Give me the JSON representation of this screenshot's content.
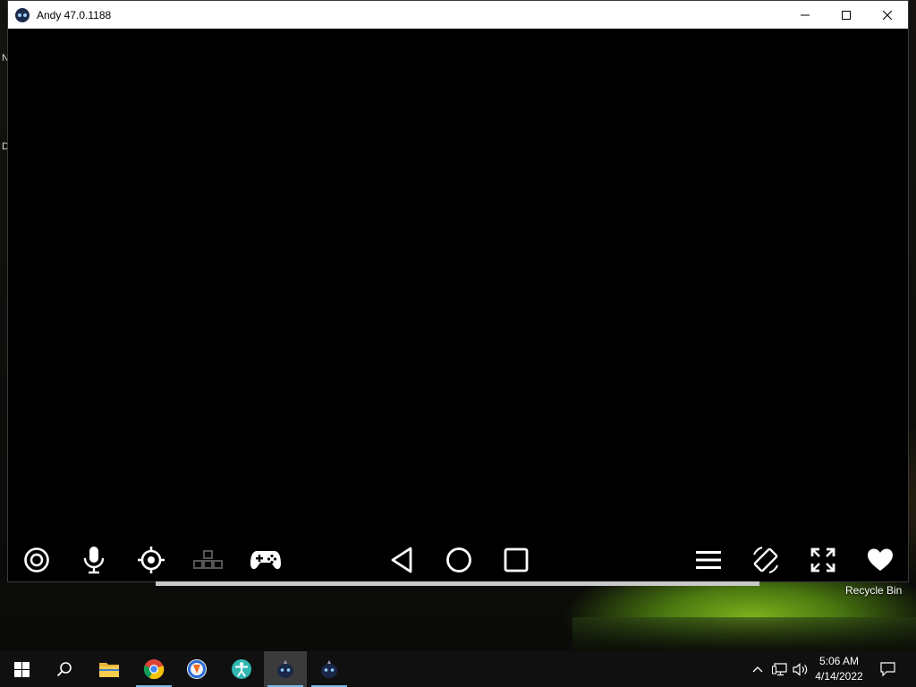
{
  "window": {
    "title": "Andy 47.0.1188",
    "app_icon": "andy-icon",
    "controls": [
      "minimize-icon",
      "maximize-icon",
      "close-icon"
    ]
  },
  "controlbar": {
    "left": [
      "camera-icon",
      "microphone-icon",
      "location-target-icon",
      "keyboard-keys-icon",
      "gamepad-icon"
    ],
    "center": [
      "back-icon",
      "home-icon",
      "recent-apps-icon"
    ],
    "right": [
      "menu-icon",
      "rotate-screen-icon",
      "fullscreen-icon",
      "favorite-heart-icon"
    ]
  },
  "desktop": {
    "edge_text_1": "N",
    "edge_text_2": "D",
    "recycle_bin_label": "Recycle Bin"
  },
  "taskbar": {
    "apps": [
      "start-icon",
      "search-icon",
      "file-explorer-icon",
      "chrome-icon",
      "brave-icon",
      "accessibility-app-icon",
      "andy-icon",
      "andy-icon"
    ],
    "clock_time": "5:06 AM",
    "clock_date": "4/14/2022"
  },
  "colors": {
    "taskbar_bg": "#101010",
    "active_underline": "#76b9ed",
    "titlebar_bg": "#ffffff"
  }
}
